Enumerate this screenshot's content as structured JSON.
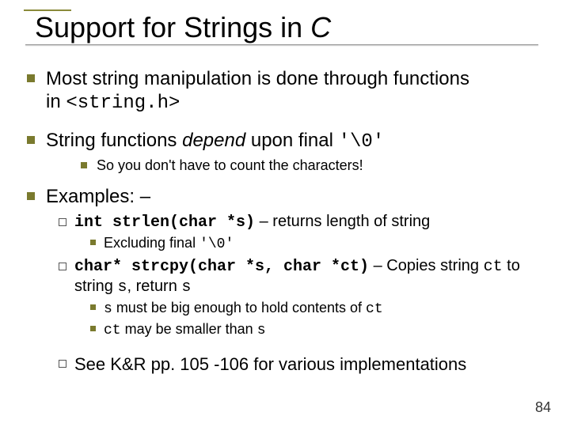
{
  "title": {
    "plain1": "Support for Strings in ",
    "italic": "C"
  },
  "b1": {
    "line1a": "Most string manipulation is done through functions",
    "line2a": "in ",
    "code": "<string.h>"
  },
  "b2": {
    "pre": "String functions ",
    "depend": "depend",
    "post": " upon final ",
    "code": "'\\0'",
    "sub": "So you don't have to count the characters!"
  },
  "b3": {
    "label": "Examples: –",
    "ex1": {
      "code": "int strlen(char *s)",
      "dash": " – returns length of string",
      "sub_pre": "Excluding final ",
      "sub_code": "'\\0'"
    },
    "ex2": {
      "code": "char* strcpy(char *s, char *ct)",
      "dash_pre": " – Copies string ",
      "ct": "ct",
      "to": " to string ",
      "s": "s",
      "ret": ", return ",
      "s2": "s",
      "sub1_s": "s",
      "sub1_mid": " must be big enough to hold contents of ",
      "sub1_ct": "ct",
      "sub2_ct": "ct",
      "sub2_mid": " may be smaller than ",
      "sub2_s": "s"
    },
    "see": "See K&R pp. 105 -106 for various implementations"
  },
  "page": "84"
}
